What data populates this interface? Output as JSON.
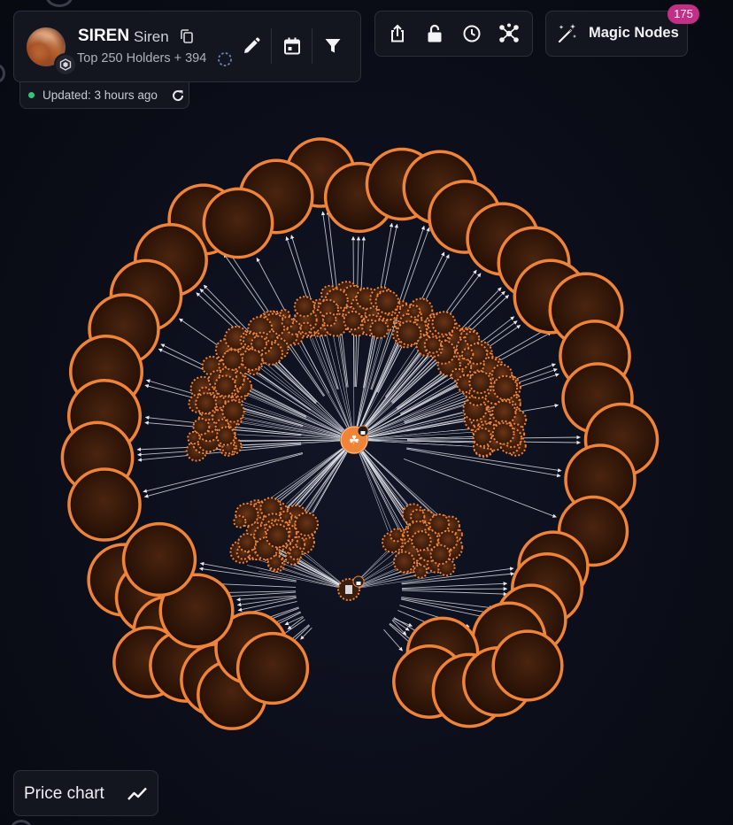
{
  "token": {
    "symbol": "SIREN",
    "name": "Siren",
    "holders_label": "Top 250 Holders + 394"
  },
  "status": {
    "updated_label": "Updated: 3 hours ago"
  },
  "toolbar": {
    "icons": [
      "edit-icon",
      "calendar-icon",
      "filter-icon",
      "share-icon",
      "unlock-icon",
      "history-icon",
      "network-icon"
    ]
  },
  "magic_nodes": {
    "label": "Magic Nodes",
    "count": "175"
  },
  "price_chart": {
    "label": "Price chart"
  },
  "colors": {
    "node_stroke": "#ef8438",
    "node_fill": "#2a1206",
    "edge": "#e6e8ef",
    "background": "#0b0d17",
    "badge": "#c22f87",
    "online": "#35c47a"
  }
}
